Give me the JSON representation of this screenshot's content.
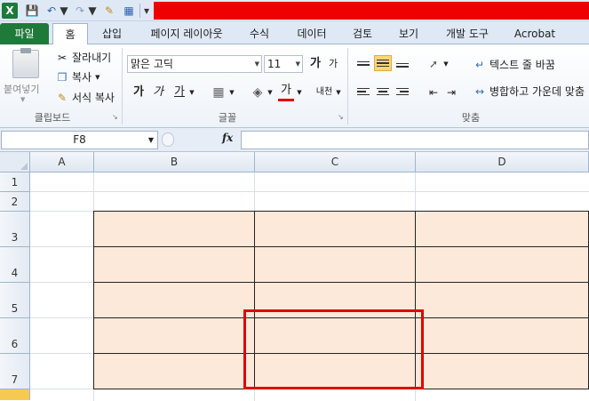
{
  "quick_access": {
    "app_icon": "X",
    "icons": [
      "excel-icon",
      "save-icon",
      "undo-icon",
      "redo-icon",
      "format-painter-icon",
      "table-icon"
    ],
    "customize_glyph": "▾"
  },
  "tabs": [
    {
      "label": "파일"
    },
    {
      "label": "홈"
    },
    {
      "label": "삽입"
    },
    {
      "label": "페이지 레이아웃"
    },
    {
      "label": "수식"
    },
    {
      "label": "데이터"
    },
    {
      "label": "검토"
    },
    {
      "label": "보기"
    },
    {
      "label": "개발 도구"
    },
    {
      "label": "Acrobat"
    }
  ],
  "ribbon": {
    "clipboard": {
      "paste": "붙여넣기",
      "cut": "잘라내기",
      "copy": "복사",
      "format_painter": "서식 복사",
      "label": "클립보드"
    },
    "font": {
      "family": "맑은 고딕",
      "size": "11",
      "grow": "가",
      "shrink": "가",
      "bold": "가",
      "italic": "가",
      "underline": "가",
      "font_color": "가",
      "phonetic": "내천",
      "label": "글꼴"
    },
    "alignment": {
      "wrap_text": "텍스트 줄 바꿈",
      "merge_center": "병합하고 가운데 맞춤",
      "label": "맞춤"
    }
  },
  "formula_bar": {
    "name_box": "F8",
    "fx": "fx",
    "formula": ""
  },
  "sheet": {
    "columns": [
      "A",
      "B",
      "C",
      "D"
    ],
    "rows": [
      "1",
      "2",
      "3",
      "4",
      "5",
      "6",
      "7"
    ],
    "table_fill": "#fde9d9",
    "highlight_color": "#e00000"
  }
}
